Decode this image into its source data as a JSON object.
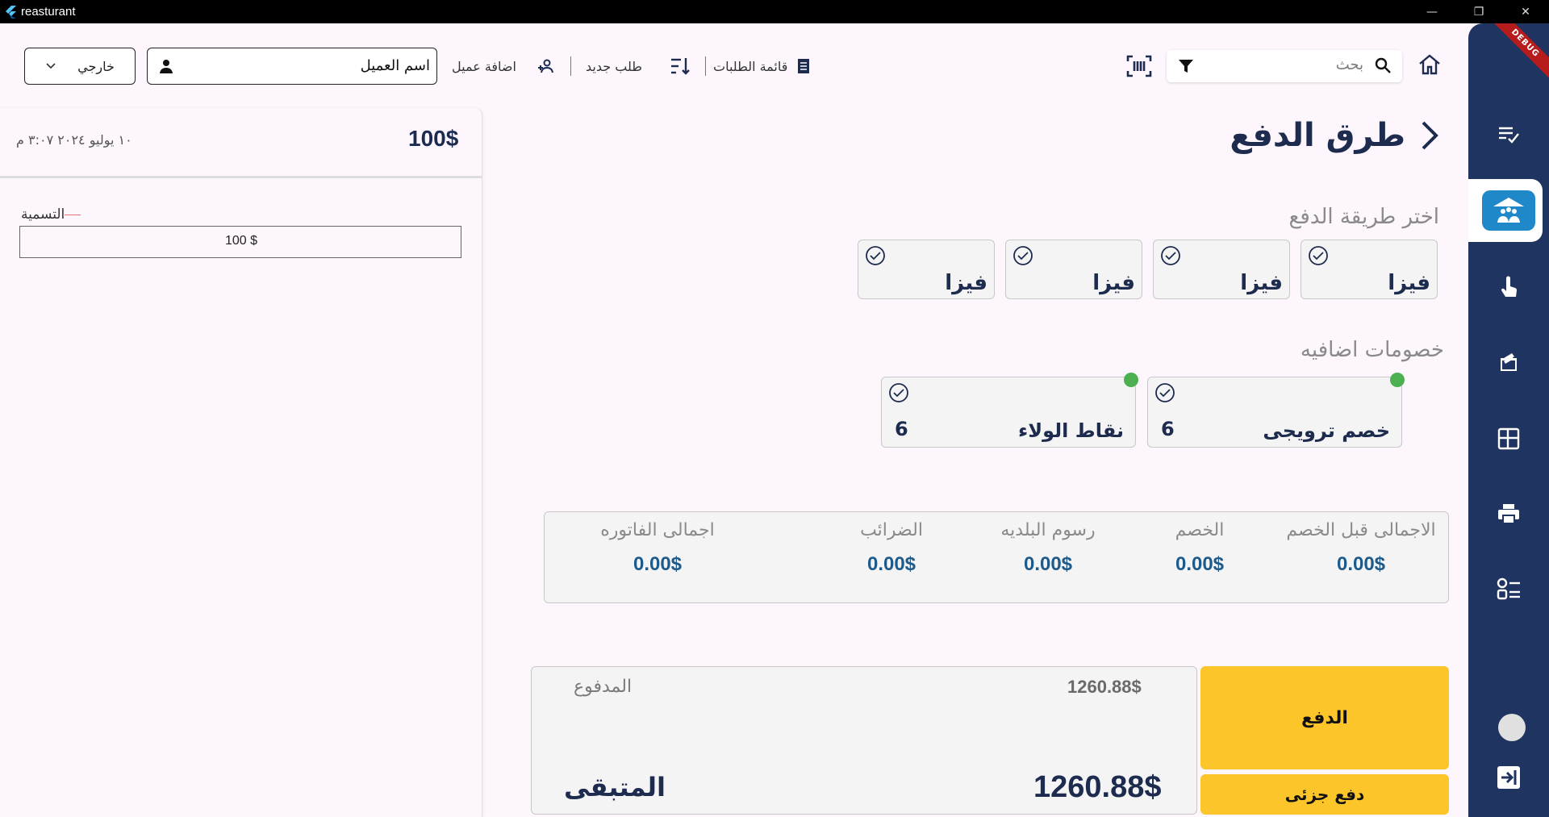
{
  "window": {
    "title": "reasturant",
    "minimize_glyph": "—",
    "restore_glyph": "❐",
    "close_glyph": "✕"
  },
  "rail": {
    "debug_label": "DEBUG",
    "items": [
      {
        "icon": "checklist-icon"
      },
      {
        "icon": "tables-people-icon",
        "active": true
      },
      {
        "icon": "touch-icon"
      },
      {
        "icon": "open-box-icon"
      },
      {
        "icon": "layout-icon"
      },
      {
        "icon": "printer-icon"
      },
      {
        "icon": "settings-list-icon"
      },
      {
        "icon": "logout-icon"
      }
    ]
  },
  "toolbar": {
    "search_label": "بحث",
    "orders_list_label": "قائمة الطلبات",
    "new_order_label": "طلب جديد",
    "add_customer_label": "اضافة عميل",
    "customer_name": "اسم العميل",
    "order_type": "خارجي"
  },
  "order_panel": {
    "amount": "100$",
    "datetime": "١٠ يوليو ٢٠٢٤  ٣:٠٧ م",
    "label_caption": "التسمية",
    "label_value": "100 $"
  },
  "payment": {
    "title": "طرق الدفع",
    "choose_method_title": "اختر طريقة الدفع",
    "methods": [
      "فيزا",
      "فيزا",
      "فيزا",
      "فيزا"
    ],
    "extra_discounts_title": "خصومات اضافيه",
    "discounts": [
      {
        "label": "خصم ترويجى",
        "value": "6"
      },
      {
        "label": "نقاط الولاء",
        "value": "6"
      }
    ],
    "totals": [
      {
        "label": "الاجمالى قبل الخصم",
        "value": "0.00$"
      },
      {
        "label": "الخصم",
        "value": "0.00$"
      },
      {
        "label": "رسوم البلديه",
        "value": "0.00$"
      },
      {
        "label": "الضرائب",
        "value": "0.00$"
      },
      {
        "label": "اجمالى الفاتوره",
        "value": "0.00$"
      }
    ],
    "paid_label": "المدفوع",
    "paid_value": "1260.88$",
    "remaining_label": "المتبقى",
    "remaining_value": "1260.88$",
    "pay_button": "الدفع",
    "partial_pay_button": "دفع جزئى"
  },
  "colors": {
    "rail_bg": "#1f3460",
    "accent_yellow": "#fcc52a",
    "title_navy": "#1d2b4f",
    "value_blue": "#1e5a8a",
    "active_item": "#1e88c9",
    "status_green": "#4caf50"
  }
}
